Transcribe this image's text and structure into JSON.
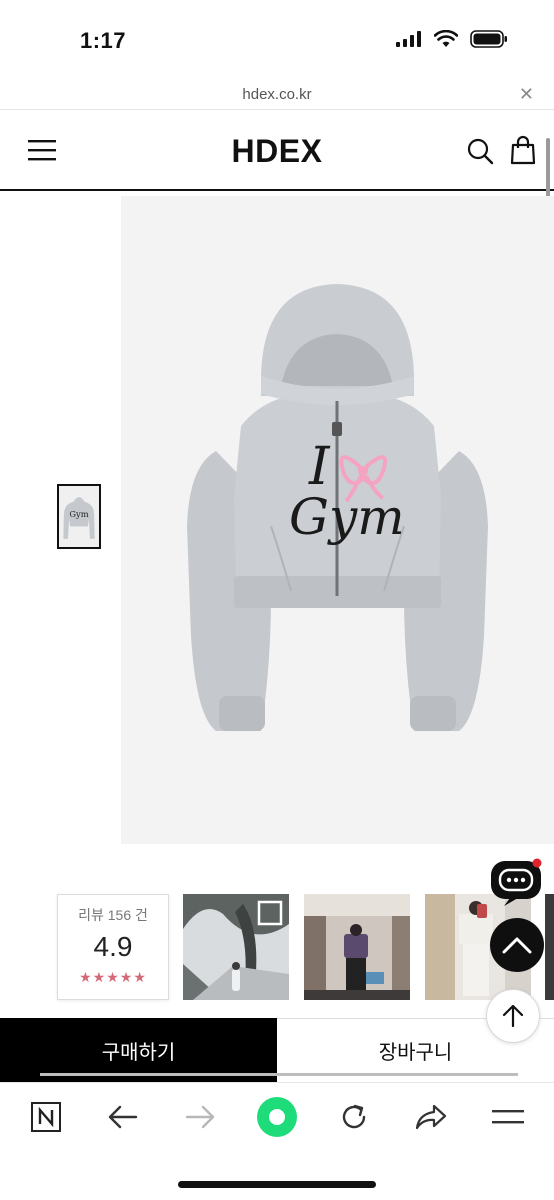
{
  "status": {
    "time": "1:17"
  },
  "address_bar": {
    "url": "hdex.co.kr",
    "close_icon": "close-icon"
  },
  "header": {
    "logo": "HDEX",
    "menu_icon": "hamburger-menu-icon",
    "search_icon": "search-icon",
    "cart_icon": "shopping-bag-icon"
  },
  "product": {
    "print_line1": "I",
    "print_line2": "Gym",
    "colors": {
      "fabric": "#c8cbd0",
      "print": "#1a1a1a",
      "bow": "#f4a3c1"
    }
  },
  "reviews": {
    "count_label": "리뷰 156 건",
    "score": "4.9",
    "stars": "★★★★★",
    "rating": 5
  },
  "actions": {
    "buy_label": "구매하기",
    "cart_label": "장바구니",
    "chat_icon": "chat-bubble-icon",
    "top_icon": "chevron-up-icon",
    "scroll_up_icon": "arrow-up-icon"
  },
  "browser_toolbar": {
    "items": [
      "naver-n-icon",
      "back-arrow-icon",
      "forward-arrow-icon",
      "green-dot-icon",
      "reload-icon",
      "share-icon",
      "menu-icon"
    ]
  },
  "theme": {
    "accent": "#000000",
    "star_color": "#d46a78",
    "green": "#1fdc7a"
  }
}
